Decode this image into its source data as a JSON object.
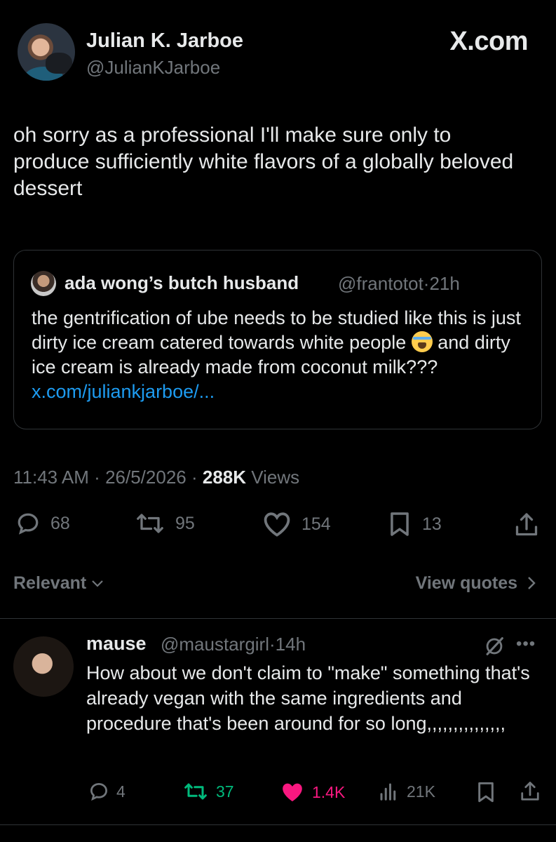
{
  "header": {
    "author_name": "Julian K. Jarboe",
    "author_handle": "@JulianKJarboe",
    "brand": "X.com"
  },
  "tweet": {
    "text": "oh sorry as a professional I'll make sure only to produce sufficiently white flavors of a globally beloved dessert"
  },
  "quote": {
    "author_name": "ada wong’s butch husband",
    "author_handle": "@frantotot",
    "separator": "·",
    "time": "21h",
    "text_before_emoji": "the gentrification of ube needs to be studied like this is just dirty ice cream catered towards white people ",
    "emoji": "crying-face-emoji",
    "text_after_emoji": " and dirty ice cream is already made from coconut milk??? ",
    "link": "x.com/juliankjarboe/..."
  },
  "meta": {
    "time": "11:43 AM",
    "separator": "·",
    "date": "26/5/2026",
    "views_count": "288K",
    "views_label": "Views"
  },
  "actions": {
    "replies": "68",
    "reposts": "95",
    "likes": "154",
    "bookmarks": "13",
    "icons": [
      "reply-icon",
      "repost-icon",
      "like-icon",
      "bookmark-icon",
      "share-icon"
    ]
  },
  "filters": {
    "sort_label": "Relevant",
    "view_quotes_label": "View quotes"
  },
  "reply": {
    "author_name": "mause",
    "author_handle": "@maustargirl",
    "separator": "·",
    "time": "14h",
    "text": "How about we don't claim to \"make\" something that's already vegan with the same ingredients and procedure that's been around for so long,,,,,,,,,,,,,,,",
    "replies": "4",
    "reposts": "37",
    "likes": "1.4K",
    "views": "21K",
    "colors": {
      "repost_active": "#00ba7c",
      "like_active": "#f91880"
    }
  }
}
